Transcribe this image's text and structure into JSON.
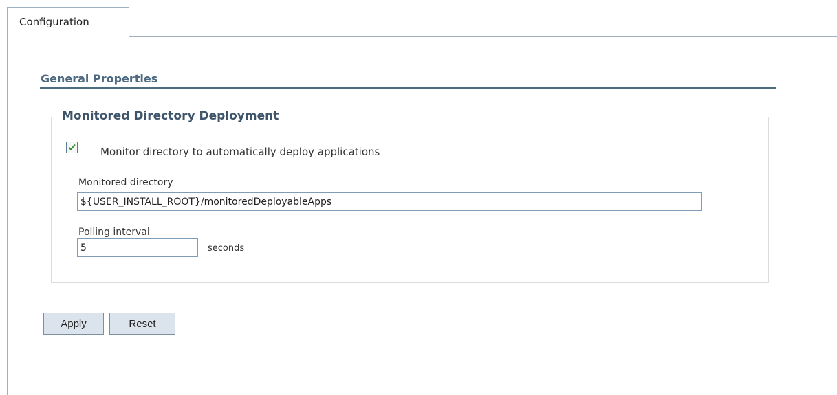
{
  "tabs": [
    {
      "label": "Configuration",
      "active": true
    }
  ],
  "section": {
    "heading": "General Properties"
  },
  "fieldset": {
    "legend": "Monitored Directory Deployment",
    "monitor_checkbox": {
      "label": "Monitor directory to automatically deploy applications",
      "checked": true
    },
    "monitored_directory": {
      "label": "Monitored directory",
      "value": "${USER_INSTALL_ROOT}/monitoredDeployableApps"
    },
    "polling_interval": {
      "label": "Polling interval",
      "value": "5",
      "unit": "seconds"
    }
  },
  "buttons": {
    "apply_label": "Apply",
    "reset_label": "Reset"
  },
  "colors": {
    "accent_rule": "#4c6c80",
    "heading": "#4d6a82",
    "legend": "#3d546a",
    "button_bg": "#dbe3ec",
    "checkmark": "#3a8a3a"
  }
}
